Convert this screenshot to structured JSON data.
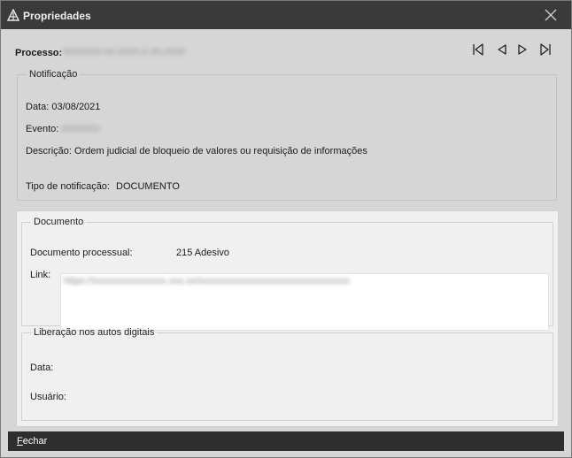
{
  "window": {
    "title": "Propriedades",
    "app_icon": "app-logo-icon",
    "close_icon": "close-icon"
  },
  "processo": {
    "label": "Processo:",
    "value": "0000000-00.0000.0.00.0000"
  },
  "nav": {
    "first_icon": "first-record-icon",
    "prev_icon": "previous-record-icon",
    "next_icon": "next-record-icon",
    "last_icon": "last-record-icon"
  },
  "notificacao": {
    "legend": "Notificação",
    "data_label": "Data:",
    "data_value": "03/08/2021",
    "evento_label": "Evento:",
    "evento_value": "0000000",
    "descricao_label": "Descrição:",
    "descricao_value": "Ordem judicial de bloqueio de valores ou requisição de informações",
    "tipo_label": "Tipo de notificação:",
    "tipo_value": "DOCUMENTO"
  },
  "documento": {
    "legend": "Documento",
    "proc_label": "Documento processual:",
    "proc_value": "215 Adesivo",
    "link_label": "Link:",
    "link_value": "https://xxxxxxxxxxxxxxx.xxx.xx/xxxxxxxxxxxxxxxxxxxxxxxxxxxxxxx"
  },
  "liberacao": {
    "legend": "Liberação nos autos digitais",
    "data_label": "Data:",
    "usuario_label": "Usuário:"
  },
  "footer": {
    "fechar_first": "F",
    "fechar_rest": "echar"
  },
  "colors": {
    "titlebar": "#3a3a3a",
    "background": "#d6d6d6",
    "panel": "#f0f0f0",
    "footer": "#2e2e2e"
  }
}
